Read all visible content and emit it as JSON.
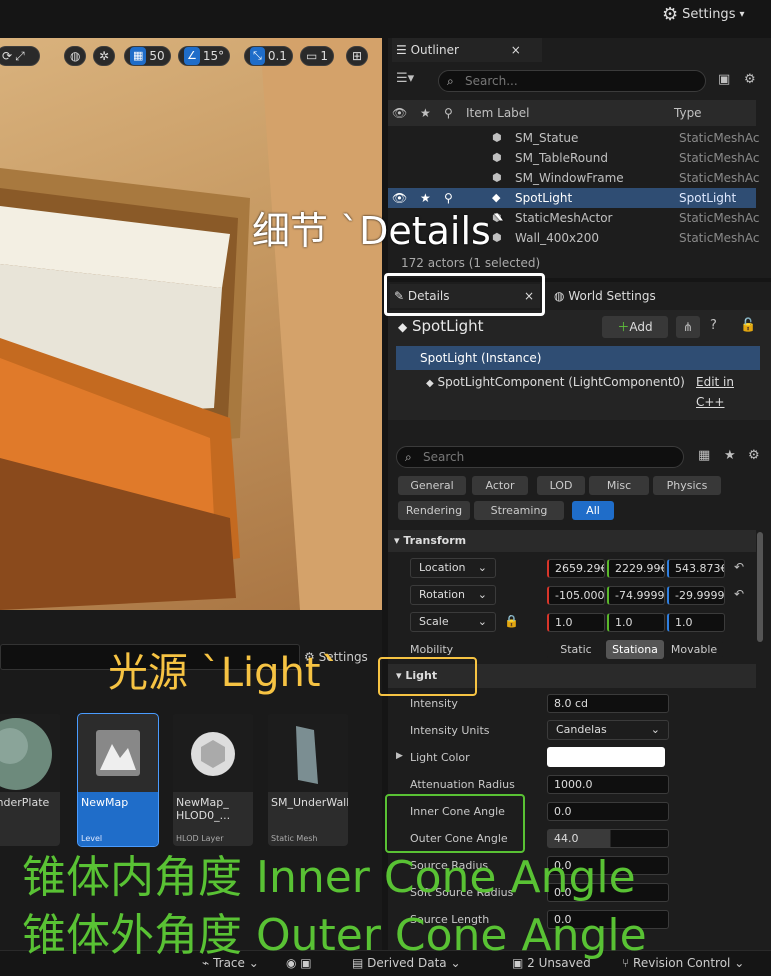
{
  "toolbar": {
    "settings_label": "Settings"
  },
  "viewport_toolbar": {
    "grid_snap": "50",
    "rot_snap": "15°",
    "scale_snap": "0.1",
    "cam_speed": "1"
  },
  "outliner": {
    "tab": "Outliner",
    "search_placeholder": "Search...",
    "col_label": "Item Label",
    "col_type": "Type",
    "rows": [
      {
        "label": "SM_Statue",
        "type": "StaticMeshAc"
      },
      {
        "label": "SM_TableRound",
        "type": "StaticMeshAc"
      },
      {
        "label": "SM_WindowFrame",
        "type": "StaticMeshAc"
      },
      {
        "label": "SpotLight",
        "type": "SpotLight"
      },
      {
        "label": "StaticMeshActor",
        "type": "StaticMeshAc"
      },
      {
        "label": "Wall_400x200",
        "type": "StaticMeshAc"
      }
    ],
    "status": "172 actors (1 selected)"
  },
  "details": {
    "tab": "Details",
    "world_tab": "World Settings",
    "actor_name": "SpotLight",
    "add_label": "Add",
    "instance": "SpotLight (Instance)",
    "component": "SpotLightComponent (LightComponent0)",
    "edit_cpp": "Edit in C++",
    "search_placeholder": "Search",
    "filters": [
      "General",
      "Actor",
      "LOD",
      "Misc",
      "Physics",
      "Rendering",
      "Streaming",
      "All"
    ],
    "transform_header": "Transform",
    "location_label": "Location",
    "location": [
      "2659.29€",
      "2229.99€",
      "543.873€"
    ],
    "rotation_label": "Rotation",
    "rotation": [
      "-105.000",
      "-74.9999",
      "-29.9999"
    ],
    "scale_label": "Scale",
    "scale": [
      "1.0",
      "1.0",
      "1.0"
    ],
    "mobility_label": "Mobility",
    "mobility": [
      "Static",
      "Stationa",
      "Movable"
    ],
    "light_header": "Light",
    "intensity_label": "Intensity",
    "intensity": "8.0 cd",
    "units_label": "Intensity Units",
    "units": "Candelas",
    "color_label": "Light Color",
    "atten_label": "Attenuation Radius",
    "atten": "1000.0",
    "inner_label": "Inner Cone Angle",
    "inner": "0.0",
    "outer_label": "Outer Cone Angle",
    "outer": "44.0",
    "src_radius_label": "Source Radius",
    "src_radius": "0.0",
    "soft_radius_label": "Soft Source Radius",
    "soft_radius": "0.0",
    "src_length_label": "Source Length",
    "src_length": "0.0"
  },
  "content": {
    "settings_label": "Settings",
    "assets": [
      {
        "name": "_UnderPlate",
        "type": "erial"
      },
      {
        "name": "NewMap",
        "type": "Level"
      },
      {
        "name": "NewMap_ HLOD0_...",
        "type": "HLOD Layer"
      },
      {
        "name": "SM_UnderWall",
        "type": "Static Mesh"
      }
    ]
  },
  "statusbar": {
    "trace": "Trace",
    "derived": "Derived Data",
    "unsaved": "2 Unsaved",
    "revision": "Revision Control"
  },
  "annotations": {
    "details": "细节 `Details`",
    "light": "光源 `Light`",
    "inner": "锥体内角度 Inner Cone Angle",
    "outer": "锥体外角度 Outer Cone Angle"
  }
}
